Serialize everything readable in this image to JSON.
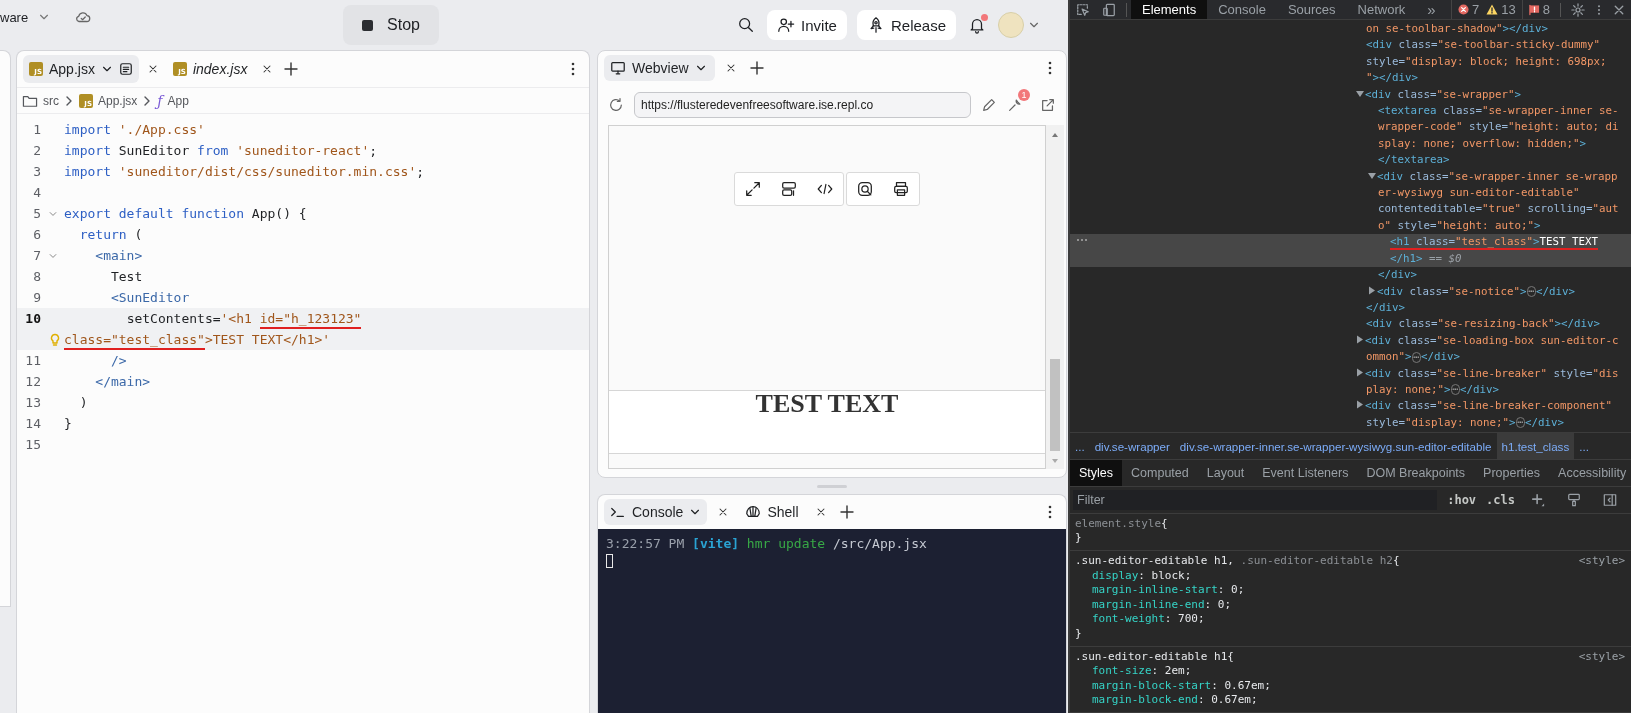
{
  "top_bar": {
    "project_name": "ware",
    "stop_button": "Stop",
    "invite_button": "Invite",
    "release_button": "Release",
    "has_notification": true
  },
  "editor": {
    "tabs": [
      {
        "label": "App.jsx",
        "badge": "JS",
        "selected": true,
        "preview": false
      },
      {
        "label": "index.jsx",
        "badge": "JS",
        "selected": false,
        "preview": true
      }
    ],
    "breadcrumb": [
      {
        "kind": "folder",
        "label": "src"
      },
      {
        "kind": "file",
        "badge": "JS",
        "label": "App.jsx"
      },
      {
        "kind": "symbol",
        "symbol": "ƒ",
        "label": "App"
      }
    ],
    "lines": [
      {
        "number": "1",
        "selected": false,
        "foldable": false,
        "hint": false,
        "tokens": [
          {
            "text": "import",
            "kind": "keyword",
            "marked": false
          },
          {
            "text": " './App.css'",
            "kind": "string",
            "marked": false
          }
        ]
      },
      {
        "number": "2",
        "selected": false,
        "foldable": false,
        "hint": false,
        "tokens": [
          {
            "text": "import",
            "kind": "keyword",
            "marked": false
          },
          {
            "text": " SunEditor ",
            "kind": "plain",
            "marked": false
          },
          {
            "text": "from",
            "kind": "keyword",
            "marked": false
          },
          {
            "text": " 'suneditor-react'",
            "kind": "string",
            "marked": false
          },
          {
            "text": ";",
            "kind": "plain",
            "marked": false
          }
        ]
      },
      {
        "number": "3",
        "selected": false,
        "foldable": false,
        "hint": false,
        "tokens": [
          {
            "text": "import",
            "kind": "keyword",
            "marked": false
          },
          {
            "text": " 'suneditor/dist/css/suneditor.min.css'",
            "kind": "string",
            "marked": false
          },
          {
            "text": ";",
            "kind": "plain",
            "marked": false
          }
        ]
      },
      {
        "number": "4",
        "selected": false,
        "foldable": false,
        "hint": false
      },
      {
        "number": "5",
        "selected": false,
        "foldable": true,
        "hint": false,
        "tokens": [
          {
            "text": "export default function",
            "kind": "keyword",
            "marked": false
          },
          {
            "text": " App() {",
            "kind": "plain",
            "marked": false
          }
        ]
      },
      {
        "number": "6",
        "selected": false,
        "foldable": false,
        "hint": false,
        "tokens": [
          {
            "text": "  return",
            "kind": "keyword",
            "marked": false
          },
          {
            "text": " (",
            "kind": "plain",
            "marked": false
          }
        ]
      },
      {
        "number": "7",
        "selected": false,
        "foldable": true,
        "hint": false,
        "tokens": [
          {
            "text": "    <main>",
            "kind": "tag",
            "marked": false
          }
        ]
      },
      {
        "number": "8",
        "selected": false,
        "foldable": false,
        "hint": false,
        "tokens": [
          {
            "text": "      Test",
            "kind": "plain",
            "marked": false
          }
        ]
      },
      {
        "number": "9",
        "selected": false,
        "foldable": false,
        "hint": false,
        "tokens": [
          {
            "text": "      <SunEditor",
            "kind": "tag",
            "marked": false
          }
        ]
      },
      {
        "number": "10",
        "selected": true,
        "foldable": false,
        "hint": true,
        "tokens": [
          {
            "text": "        setContents=",
            "kind": "plain",
            "marked": false
          },
          {
            "text": "'<h1 ",
            "kind": "string",
            "marked": false
          },
          {
            "text": "id=\"h_123123\"",
            "kind": "string",
            "marked": true
          },
          {
            "kind": "break"
          },
          {
            "text": "class=\"test_class\"",
            "kind": "string",
            "marked": true
          },
          {
            "text": ">TEST TEXT</h1>'",
            "kind": "string",
            "marked": false
          }
        ]
      },
      {
        "number": "11",
        "selected": false,
        "foldable": false,
        "hint": false,
        "tokens": [
          {
            "text": "      />",
            "kind": "tag",
            "marked": false
          }
        ]
      },
      {
        "number": "12",
        "selected": false,
        "foldable": false,
        "hint": false,
        "tokens": [
          {
            "text": "    </main>",
            "kind": "tag",
            "marked": false
          }
        ]
      },
      {
        "number": "13",
        "selected": false,
        "foldable": false,
        "hint": false,
        "tokens": [
          {
            "text": "  )",
            "kind": "plain",
            "marked": false
          }
        ]
      },
      {
        "number": "14",
        "selected": false,
        "foldable": false,
        "hint": false,
        "tokens": [
          {
            "text": "}",
            "kind": "plain",
            "marked": false
          }
        ]
      },
      {
        "number": "15",
        "selected": false,
        "foldable": false,
        "hint": false
      }
    ]
  },
  "webview": {
    "tab": "Webview",
    "url": "https://flusteredevenfreesoftware.ise.repl.co",
    "tools_badge": "1",
    "page_heading": "TEST TEXT"
  },
  "console": {
    "tabs": [
      {
        "label": "Console",
        "kind": "console",
        "selected": true
      },
      {
        "label": "Shell",
        "kind": "shell",
        "selected": false
      }
    ],
    "output": [
      {
        "text": "3:22:57 PM",
        "kind": "time"
      },
      {
        "text": "[vite]",
        "kind": "source"
      },
      {
        "text": "hmr update",
        "kind": "message"
      },
      {
        "text": "/src/App.jsx",
        "kind": "path"
      }
    ]
  },
  "devtools": {
    "tabs": [
      {
        "label": "Elements",
        "selected": true
      },
      {
        "label": "Console",
        "selected": false
      },
      {
        "label": "Sources",
        "selected": false
      },
      {
        "label": "Network",
        "selected": false
      }
    ],
    "overflow": "»",
    "errors": "7",
    "warnings": "13",
    "issues": "8",
    "dom_tree": [
      {
        "selected": false,
        "underlined": false,
        "tokens": [
          {
            "text": "on se-toolbar-shadow\"",
            "kind": "value"
          },
          {
            "text": "></div>",
            "kind": "tag"
          }
        ]
      },
      {
        "selected": false,
        "underlined": false,
        "tokens": [
          {
            "text": "<div",
            "kind": "tag"
          },
          {
            "text": " class=",
            "kind": "attr"
          },
          {
            "text": "\"se-toolbar-sticky-dummy\"",
            "kind": "value"
          },
          {
            "text": " style=",
            "kind": "attr"
          },
          {
            "text": "\"display: block; height: 698px; \"",
            "kind": "value"
          },
          {
            "text": "></div>",
            "kind": "tag"
          }
        ]
      },
      {
        "expanded": true,
        "selected": false,
        "underlined": false,
        "tokens": [
          {
            "text": "<div",
            "kind": "tag"
          },
          {
            "text": " class=",
            "kind": "attr"
          },
          {
            "text": "\"se-wrapper\"",
            "kind": "value"
          },
          {
            "text": ">",
            "kind": "tag"
          }
        ],
        "children": [
          {
            "selected": false,
            "underlined": false,
            "tokens": [
              {
                "text": "<textarea",
                "kind": "tag"
              },
              {
                "text": " class=",
                "kind": "attr"
              },
              {
                "text": "\"se-wrapper-inner se-wrapper-code\"",
                "kind": "value"
              },
              {
                "text": " style=",
                "kind": "attr"
              },
              {
                "text": "\"height: auto; display: none; overflow: hidden;\"",
                "kind": "value"
              },
              {
                "text": ">",
                "kind": "tag"
              }
            ],
            "closing": [
              {
                "text": "</textarea>",
                "kind": "tag"
              }
            ]
          },
          {
            "expanded": true,
            "selected": false,
            "underlined": false,
            "tokens": [
              {
                "text": "<div",
                "kind": "tag"
              },
              {
                "text": " class=",
                "kind": "attr"
              },
              {
                "text": "\"se-wrapper-inner se-wrapper-wysiwyg sun-editor-editable\"",
                "kind": "value"
              },
              {
                "text": " contenteditable=",
                "kind": "attr"
              },
              {
                "text": "\"true\"",
                "kind": "value"
              },
              {
                "text": " scrolling=",
                "kind": "attr"
              },
              {
                "text": "\"auto\"",
                "kind": "value"
              },
              {
                "text": " style=",
                "kind": "attr"
              },
              {
                "text": "\"height: auto;\"",
                "kind": "value"
              },
              {
                "text": ">",
                "kind": "tag"
              }
            ],
            "children": [
              {
                "selected": true,
                "underlined": true,
                "tokens": [
                  {
                    "text": "<h1",
                    "kind": "tag"
                  },
                  {
                    "text": " class=",
                    "kind": "attr"
                  },
                  {
                    "text": "\"test_class\"",
                    "kind": "value"
                  },
                  {
                    "text": ">",
                    "kind": "tag"
                  },
                  {
                    "text": "TEST TEXT",
                    "kind": "text"
                  },
                  {
                    "kind": "break"
                  },
                  {
                    "text": "</h1>",
                    "kind": "tag"
                  },
                  {
                    "text": " == $0",
                    "kind": "note"
                  }
                ]
              }
            ],
            "closing": [
              {
                "text": "</div>",
                "kind": "tag"
              }
            ]
          },
          {
            "expanded": false,
            "selected": false,
            "underlined": false,
            "tokens": [
              {
                "text": "<div",
                "kind": "tag"
              },
              {
                "text": " class=",
                "kind": "attr"
              },
              {
                "text": "\"se-notice\"",
                "kind": "value"
              },
              {
                "text": ">",
                "kind": "tag"
              },
              {
                "text": "⋯",
                "kind": "ellipsis"
              },
              {
                "text": "</div>",
                "kind": "tag"
              }
            ]
          }
        ],
        "closing": [
          {
            "text": "</div>",
            "kind": "tag"
          }
        ]
      },
      {
        "selected": false,
        "underlined": false,
        "tokens": [
          {
            "text": "<div",
            "kind": "tag"
          },
          {
            "text": " class=",
            "kind": "attr"
          },
          {
            "text": "\"se-resizing-back\"",
            "kind": "value"
          },
          {
            "text": "></div>",
            "kind": "tag"
          }
        ]
      },
      {
        "expanded": false,
        "selected": false,
        "underlined": false,
        "tokens": [
          {
            "text": "<div",
            "kind": "tag"
          },
          {
            "text": " class=",
            "kind": "attr"
          },
          {
            "text": "\"se-loading-box sun-editor-common\"",
            "kind": "value"
          },
          {
            "text": ">",
            "kind": "tag"
          },
          {
            "text": "⋯",
            "kind": "ellipsis"
          },
          {
            "text": "</div>",
            "kind": "tag"
          }
        ]
      },
      {
        "expanded": false,
        "selected": false,
        "underlined": false,
        "tokens": [
          {
            "text": "<div",
            "kind": "tag"
          },
          {
            "text": " class=",
            "kind": "attr"
          },
          {
            "text": "\"se-line-breaker\"",
            "kind": "value"
          },
          {
            "text": " style=",
            "kind": "attr"
          },
          {
            "text": "\"display: none;\"",
            "kind": "value"
          },
          {
            "text": ">",
            "kind": "tag"
          },
          {
            "text": "⋯",
            "kind": "ellipsis"
          },
          {
            "text": "</div>",
            "kind": "tag"
          }
        ]
      },
      {
        "expanded": false,
        "selected": false,
        "underlined": false,
        "tokens": [
          {
            "text": "<div",
            "kind": "tag"
          },
          {
            "text": " class=",
            "kind": "attr"
          },
          {
            "text": "\"se-line-breaker-component\"",
            "kind": "value"
          },
          {
            "text": " style=",
            "kind": "attr"
          },
          {
            "text": "\"display: none;\"",
            "kind": "value"
          },
          {
            "text": ">",
            "kind": "tag"
          },
          {
            "text": "⋯",
            "kind": "ellipsis"
          },
          {
            "text": "</div>",
            "kind": "tag"
          }
        ]
      }
    ],
    "breadcrumb": [
      {
        "label": "...",
        "selected": false
      },
      {
        "label": "div.se-wrapper",
        "selected": false
      },
      {
        "label": "div.se-wrapper-inner.se-wrapper-wysiwyg.sun-editor-editable",
        "selected": false
      },
      {
        "label": "h1.test_class",
        "selected": true
      },
      {
        "label": "...",
        "selected": false
      }
    ],
    "style_tabs": [
      {
        "label": "Styles",
        "selected": true
      },
      {
        "label": "Computed",
        "selected": false
      },
      {
        "label": "Layout",
        "selected": false
      },
      {
        "label": "Event Listeners",
        "selected": false
      },
      {
        "label": "DOM Breakpoints",
        "selected": false
      },
      {
        "label": "Properties",
        "selected": false
      },
      {
        "label": "Accessibility",
        "selected": false
      }
    ],
    "filter": {
      "placeholder": "Filter"
    },
    "filter_tools": [
      ":hov",
      ".cls"
    ],
    "rules": [
      {
        "selectors": [
          {
            "text": "element.style",
            "matched": false
          }
        ],
        "open": "{",
        "close": "}"
      },
      {
        "selectors": [
          {
            "text": ".sun-editor-editable h1,",
            "matched": true
          },
          {
            "text": ".sun-editor-editable h2",
            "matched": false
          }
        ],
        "open": "{",
        "close": "}",
        "source": "<style>",
        "properties": [
          {
            "name": "display",
            "punct": ":",
            "value": "block;"
          },
          {
            "name": "margin-inline-start",
            "punct": ":",
            "value": "0;"
          },
          {
            "name": "margin-inline-end",
            "punct": ":",
            "value": "0;"
          },
          {
            "name": "font-weight",
            "punct": ":",
            "value": "700;"
          }
        ]
      },
      {
        "selectors": [
          {
            "text": ".sun-editor-editable h1",
            "matched": true
          }
        ],
        "open": "{",
        "source": "<style>",
        "properties": [
          {
            "name": "font-size",
            "punct": ":",
            "value": "2em;"
          },
          {
            "name": "margin-block-start",
            "punct": ":",
            "value": "0.67em;"
          },
          {
            "name": "margin-block-end",
            "punct": ":",
            "value": "0.67em;"
          }
        ]
      }
    ]
  }
}
